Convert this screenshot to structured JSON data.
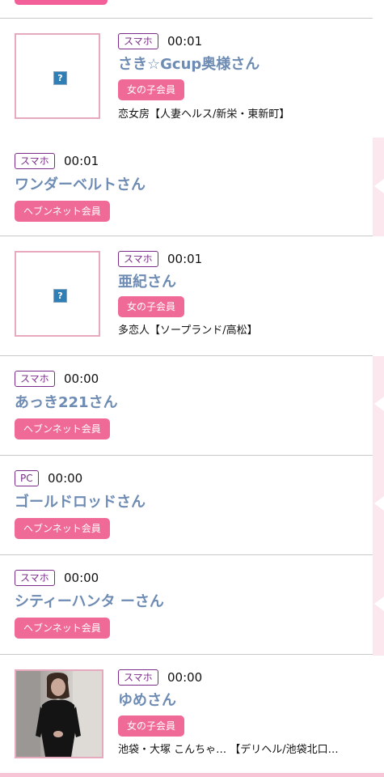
{
  "colors": {
    "accent": "#f06a98",
    "name_text": "#6e8cb3",
    "device_border": "#7b2c8a"
  },
  "entries": [
    {
      "device": "スマホ",
      "time": "00:01",
      "name": "さき☆Gcup奥様さん",
      "member": "女の子会員",
      "shop": "恋女房【人妻ヘルス/新栄・東新町】",
      "thumb": "broken-image-icon"
    },
    {
      "device": "スマホ",
      "time": "00:01",
      "name": "ワンダーベルトさん",
      "member": "ヘブンネット会員"
    },
    {
      "device": "スマホ",
      "time": "00:01",
      "name": "亜紀さん",
      "member": "女の子会員",
      "shop": "多恋人【ソープランド/高松】",
      "thumb": "broken-image-icon"
    },
    {
      "device": "スマホ",
      "time": "00:00",
      "name": "あっき221さん",
      "member": "ヘブンネット会員"
    },
    {
      "device": "PC",
      "time": "00:00",
      "name": "ゴールドロッドさん",
      "member": "ヘブンネット会員"
    },
    {
      "device": "スマホ",
      "time": "00:00",
      "name": "シティーハンタ ーさん",
      "member": "ヘブンネット会員"
    },
    {
      "device": "スマホ",
      "time": "00:00",
      "name": "ゆめさん",
      "member": "女の子会員",
      "shop": "池袋・大塚 こんちゃ… 【デリヘル/池袋北口…",
      "thumb": "profile-photo"
    }
  ]
}
